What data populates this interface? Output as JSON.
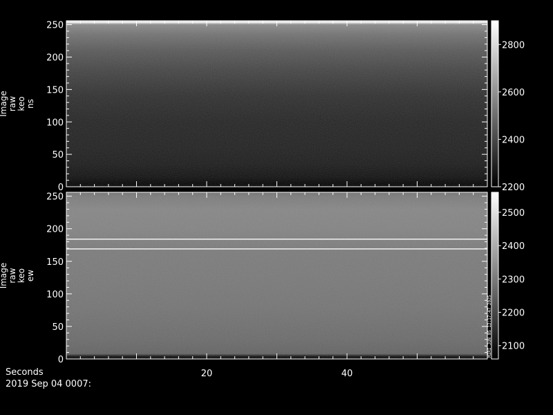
{
  "chart_data": {
    "type": "heatmap",
    "x_axis": {
      "label": "Seconds",
      "range": [
        0,
        60
      ],
      "ticks": [
        20,
        40
      ]
    },
    "date_label": "2019 Sep 04 0007:",
    "panels": [
      {
        "ylabel": [
          "Image",
          "raw",
          "keo",
          "ns"
        ],
        "ylim": [
          0,
          256
        ],
        "yticks": [
          0,
          50,
          100,
          150,
          200,
          250
        ],
        "colorbar": {
          "range": [
            2200,
            2900
          ],
          "ticks": [
            2200,
            2400,
            2600,
            2800
          ]
        },
        "colormap": "grayscale",
        "profile": [
          [
            0,
            2210
          ],
          [
            5,
            2200
          ],
          [
            15,
            2235
          ],
          [
            35,
            2265
          ],
          [
            60,
            2280
          ],
          [
            100,
            2290
          ],
          [
            140,
            2320
          ],
          [
            180,
            2380
          ],
          [
            210,
            2440
          ],
          [
            235,
            2510
          ],
          [
            250,
            2580
          ],
          [
            254,
            2900
          ],
          [
            256,
            2700
          ]
        ],
        "bright_rows": [
          254
        ]
      },
      {
        "ylabel": [
          "Image",
          "raw",
          "keo",
          "ew"
        ],
        "ylim": [
          0,
          256
        ],
        "yticks": [
          0,
          50,
          100,
          150,
          200,
          250
        ],
        "colorbar": {
          "range": [
            2060,
            2560
          ],
          "ticks": [
            2100,
            2200,
            2300,
            2400,
            2500
          ]
        },
        "colormap": "grayscale",
        "profile": [
          [
            0,
            2060
          ],
          [
            4,
            2090
          ],
          [
            8,
            2250
          ],
          [
            30,
            2265
          ],
          [
            80,
            2285
          ],
          [
            130,
            2295
          ],
          [
            168,
            2300
          ],
          [
            200,
            2315
          ],
          [
            230,
            2320
          ],
          [
            250,
            2300
          ],
          [
            256,
            2280
          ]
        ],
        "bright_rows": [
          169,
          184
        ],
        "annotation": "MIRI JUN 05 12:17:47 2025"
      }
    ]
  }
}
